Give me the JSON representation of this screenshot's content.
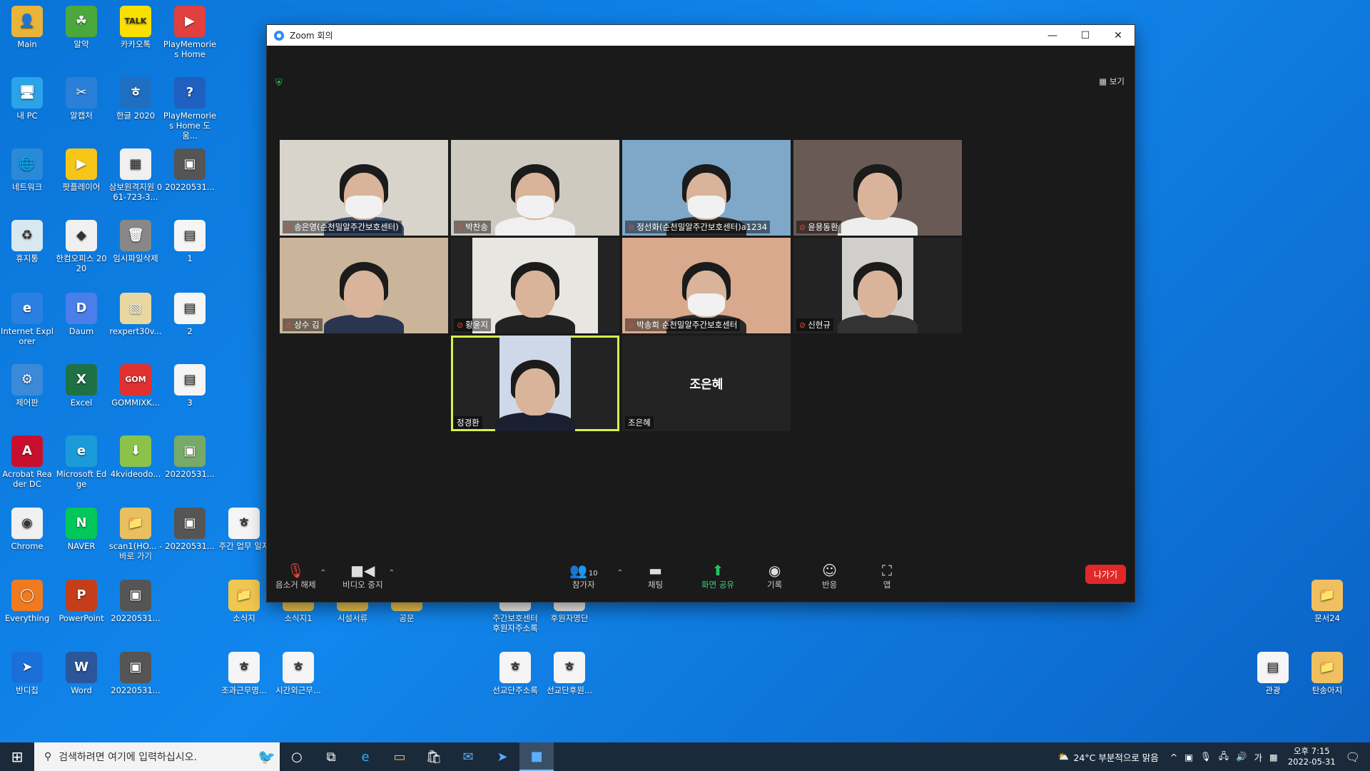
{
  "desktop": {
    "icons": [
      {
        "label": "Main",
        "bg": "#e8b43a",
        "glyph": "👤"
      },
      {
        "label": "알약",
        "bg": "#4aa83c",
        "glyph": "☘"
      },
      {
        "label": "카카오톡",
        "bg": "#f9e000",
        "glyph": "TALK"
      },
      {
        "label": "PlayMemories Home",
        "bg": "#e04040",
        "glyph": "▶"
      },
      {
        "label": "내 PC",
        "bg": "#2aa3e8",
        "glyph": "🖥"
      },
      {
        "label": "알캡처",
        "bg": "#2a80d8",
        "glyph": "✂"
      },
      {
        "label": "한글 2020",
        "bg": "#1f6fc0",
        "glyph": "ㅎ"
      },
      {
        "label": "PlayMemories Home 도움...",
        "bg": "#1f5fc0",
        "glyph": "?"
      },
      {
        "label": "네트워크",
        "bg": "#2a8ad8",
        "glyph": "🌐"
      },
      {
        "label": "팟플레이어",
        "bg": "#f5c518",
        "glyph": "▶"
      },
      {
        "label": "삼보원격지원 061-723-3...",
        "bg": "#f0f0f0",
        "glyph": "▦"
      },
      {
        "label": "20220531...",
        "bg": "#555",
        "glyph": "▣"
      },
      {
        "label": "휴지통",
        "bg": "#d8e8f0",
        "glyph": "♻"
      },
      {
        "label": "한컴오피스 2020",
        "bg": "#f0f0f0",
        "glyph": "◆"
      },
      {
        "label": "임시파일삭제",
        "bg": "#888",
        "glyph": "🗑"
      },
      {
        "label": "1",
        "bg": "#f5f5f5",
        "glyph": "▤"
      },
      {
        "label": "Internet Explorer",
        "bg": "#2a80e0",
        "glyph": "e"
      },
      {
        "label": "Daum",
        "bg": "#4a7ee8",
        "glyph": "D"
      },
      {
        "label": "rexpert30v...",
        "bg": "#e8d8a0",
        "glyph": "▧"
      },
      {
        "label": "2",
        "bg": "#f5f5f5",
        "glyph": "▤"
      },
      {
        "label": "제어판",
        "bg": "#3a8ad8",
        "glyph": "⚙"
      },
      {
        "label": "Excel",
        "bg": "#1e7145",
        "glyph": "X"
      },
      {
        "label": "GOMMIXK...",
        "bg": "#e03030",
        "glyph": "GOM"
      },
      {
        "label": "3",
        "bg": "#f5f5f5",
        "glyph": "▤"
      },
      {
        "label": "Acrobat Reader DC",
        "bg": "#c8102e",
        "glyph": "A"
      },
      {
        "label": "Microsoft Edge",
        "bg": "#1a9bd7",
        "glyph": "e"
      },
      {
        "label": "4kvideodo...",
        "bg": "#8bc34a",
        "glyph": "⬇"
      },
      {
        "label": "20220531...",
        "bg": "#7a6",
        "glyph": "▣"
      },
      {
        "label": "Chrome",
        "bg": "#f0f0f0",
        "glyph": "◉"
      },
      {
        "label": "NAVER",
        "bg": "#03c75a",
        "glyph": "N"
      },
      {
        "label": "scan1(HO... - 바로 가기",
        "bg": "#e8c060",
        "glyph": "📁"
      },
      {
        "label": "20220531...",
        "bg": "#555",
        "glyph": "▣"
      },
      {
        "label": "주간 업무 일지",
        "bg": "#f5f5f5",
        "glyph": "ㅎ"
      },
      {
        "label": "Everything",
        "bg": "#f07a20",
        "glyph": "◯"
      },
      {
        "label": "PowerPoint",
        "bg": "#c43e1c",
        "glyph": "P"
      },
      {
        "label": "20220531...",
        "bg": "#555",
        "glyph": "▣"
      },
      {
        "label": "소식지",
        "bg": "#f0c850",
        "glyph": "📁"
      },
      {
        "label": "소식지1",
        "bg": "#f0c850",
        "glyph": "📁"
      },
      {
        "label": "시설서류",
        "bg": "#f0c850",
        "glyph": "📁"
      },
      {
        "label": "공문",
        "bg": "#f0c850",
        "glyph": "📁"
      },
      {
        "label": "주간보호센터 후원자주소록",
        "bg": "#f5f5f5",
        "glyph": "ㅎ"
      },
      {
        "label": "후원자명단",
        "bg": "#f5f5f5",
        "glyph": "ㅎ"
      },
      {
        "label": "반디집",
        "bg": "#1a6fd8",
        "glyph": "➤"
      },
      {
        "label": "Word",
        "bg": "#2b579a",
        "glyph": "W"
      },
      {
        "label": "20220531...",
        "bg": "#555",
        "glyph": "▣"
      },
      {
        "label": "조과근무명...",
        "bg": "#f5f5f5",
        "glyph": "ㅎ"
      },
      {
        "label": "시간외근무...",
        "bg": "#f5f5f5",
        "glyph": "ㅎ"
      },
      {
        "label": "선교단주소록",
        "bg": "#f5f5f5",
        "glyph": "ㅎ"
      },
      {
        "label": "선교단후원...",
        "bg": "#f5f5f5",
        "glyph": "ㅎ"
      },
      {
        "label": "문서24",
        "bg": "#f0c060",
        "glyph": "📁"
      },
      {
        "label": "관광",
        "bg": "#f5f5f5",
        "glyph": "▤"
      },
      {
        "label": "탄송아지",
        "bg": "#f0c060",
        "glyph": "📁"
      }
    ]
  },
  "zoom": {
    "title": "Zoom 회의",
    "view_label": "보기",
    "participants": [
      {
        "name": "송은영(순천밀알주간보호센터)",
        "muted": true,
        "bg": "#d8d4cc"
      },
      {
        "name": "박찬송",
        "muted": true,
        "bg": "#cfcac0"
      },
      {
        "name": "정선화(순천밀알주간보호센터)a1234",
        "muted": true,
        "bg": "#7fa8c8"
      },
      {
        "name": "윤용동환",
        "muted": true,
        "bg": "#6a5a55"
      },
      {
        "name": "상수 김",
        "muted": true,
        "bg": "#cbb59a"
      },
      {
        "name": "황윤지",
        "muted": true,
        "bg": "#e8e6e0"
      },
      {
        "name": "박송희 순천밀알주간보호센터",
        "muted": true,
        "bg": "#d9a98e"
      },
      {
        "name": "신현규",
        "muted": true,
        "bg": "#d0cfcb"
      },
      {
        "name": "정경환",
        "muted": false,
        "bg": "#cfd8e8"
      },
      {
        "name": "조은혜",
        "muted": false,
        "bg": "#232323",
        "display_name": "조은혜"
      }
    ],
    "toolbar": {
      "unmute": "음소거 해제",
      "video": "비디오 중지",
      "participants": "참가자",
      "participants_count": "10",
      "chat": "채팅",
      "share": "화면 공유",
      "record": "기록",
      "reactions": "반응",
      "apps": "앱",
      "leave": "나가기"
    }
  },
  "taskbar": {
    "search_placeholder": "검색하려면 여기에 입력하십시오.",
    "weather": "24°C 부분적으로 맑음",
    "ime": "가",
    "time": "오후 7:15",
    "date": "2022-05-31"
  }
}
